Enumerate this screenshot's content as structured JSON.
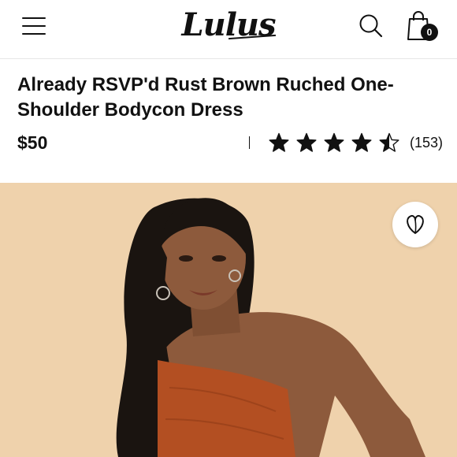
{
  "header": {
    "menu_icon": "hamburger-menu-icon",
    "logo_text": "Lulus",
    "search_icon": "search-icon",
    "bag_icon": "shopping-bag-icon",
    "bag_count": "0"
  },
  "product": {
    "title": "Already RSVP'd Rust Brown Ruched One-Shoulder Bodycon Dress",
    "price": "$50",
    "rating": 4.5,
    "rating_max": 5,
    "review_count": "(153)",
    "image_icon": "wishlist-heart-icon"
  },
  "colors": {
    "backdrop": "#efd2ac",
    "dress": "#b34f22",
    "skin": "#8d5a3c",
    "hair": "#1a1410"
  }
}
